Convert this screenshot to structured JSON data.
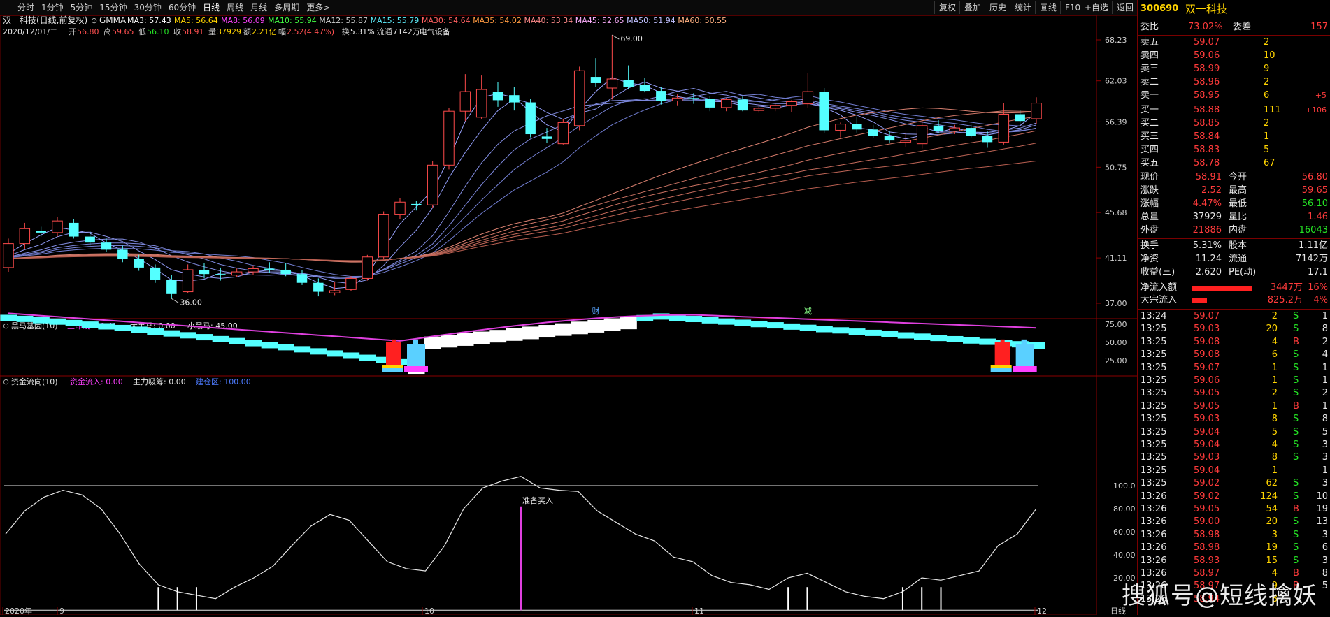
{
  "toolbar": {
    "periods": [
      "分时",
      "1分钟",
      "5分钟",
      "15分钟",
      "30分钟",
      "60分钟",
      "日线",
      "周线",
      "月线",
      "多周期",
      "更多>"
    ],
    "active_period": "日线",
    "right_buttons": [
      "复权",
      "叠加",
      "历史",
      "统计",
      "画线",
      "F10",
      "+自选",
      "返回"
    ]
  },
  "header": {
    "title": "双一科技(日线,前复权)",
    "indicator": "GMMA",
    "mas": [
      "MA3: 57.43",
      "MA5: 56.64",
      "MA8: 56.09",
      "MA10: 55.94",
      "MA12: 55.87",
      "MA15: 55.79",
      "MA30: 54.64",
      "MA35: 54.02",
      "MA40: 53.34",
      "MA45: 52.65",
      "MA50: 51.94",
      "MA60: 50.55"
    ],
    "info_date": "2020/12/01/二",
    "info_items": [
      {
        "k": "开",
        "v": "56.80"
      },
      {
        "k": "高",
        "v": "59.65"
      },
      {
        "k": "低",
        "v": "56.10"
      },
      {
        "k": "收",
        "v": "58.91"
      },
      {
        "k": "量",
        "v": "37929"
      },
      {
        "k": "额",
        "v": "2.21亿"
      },
      {
        "k": "幅",
        "v": "2.52(4.47%)"
      },
      {
        "k": "换",
        "v": "5.31%"
      },
      {
        "k": "流通",
        "v": "7142万"
      }
    ],
    "sector": "电气设备"
  },
  "chart_data": [
    {
      "type": "candlestick",
      "title": "双一科技(日线,前复权)",
      "y_ticks": [
        37.0,
        41.11,
        45.68,
        50.75,
        56.39,
        62.03,
        68.23
      ],
      "annotations": [
        {
          "text": "69.00",
          "x": 35
        },
        {
          "text": "36.00",
          "x": 10
        }
      ],
      "markers": [
        {
          "text": "财",
          "x": 36
        },
        {
          "text": "减",
          "x": 49
        }
      ],
      "candles": [
        [
          40.2,
          43.0,
          39.8,
          42.5
        ],
        [
          42.5,
          44.6,
          42.0,
          44.0
        ],
        [
          43.8,
          44.2,
          43.2,
          43.6
        ],
        [
          43.6,
          45.2,
          43.2,
          44.8
        ],
        [
          44.6,
          45.0,
          43.0,
          43.2
        ],
        [
          43.2,
          43.8,
          42.3,
          42.6
        ],
        [
          42.6,
          43.0,
          41.7,
          41.9
        ],
        [
          41.9,
          42.3,
          40.7,
          41.0
        ],
        [
          41.0,
          41.4,
          39.9,
          40.2
        ],
        [
          40.2,
          40.5,
          38.8,
          39.1
        ],
        [
          39.1,
          39.5,
          37.4,
          37.8
        ],
        [
          38.0,
          40.5,
          37.9,
          40.0
        ],
        [
          40.0,
          40.6,
          39.2,
          39.6
        ],
        [
          39.6,
          40.2,
          39.0,
          39.5
        ],
        [
          39.5,
          40.1,
          39.3,
          39.8
        ],
        [
          39.8,
          40.4,
          39.5,
          40.1
        ],
        [
          40.1,
          40.7,
          39.7,
          40.0
        ],
        [
          40.0,
          40.6,
          39.4,
          39.6
        ],
        [
          39.6,
          40.0,
          38.6,
          38.8
        ],
        [
          38.8,
          39.2,
          37.6,
          38.0
        ],
        [
          37.9,
          38.9,
          37.7,
          38.1
        ],
        [
          38.2,
          39.4,
          38.1,
          39.2
        ],
        [
          39.2,
          41.4,
          39.0,
          41.2
        ],
        [
          41.2,
          45.8,
          41.0,
          45.5
        ],
        [
          45.5,
          47.2,
          45.0,
          46.8
        ],
        [
          46.6,
          46.9,
          45.9,
          46.5
        ],
        [
          46.5,
          51.5,
          46.2,
          51.0
        ],
        [
          51.0,
          58.2,
          50.5,
          57.8
        ],
        [
          57.8,
          63.0,
          56.5,
          60.5
        ],
        [
          57.0,
          62.8,
          56.8,
          60.8
        ],
        [
          60.5,
          61.8,
          58.4,
          59.3
        ],
        [
          60.0,
          61.2,
          57.9,
          59.0
        ],
        [
          59.0,
          59.5,
          54.4,
          54.8
        ],
        [
          54.5,
          55.6,
          53.7,
          54.2
        ],
        [
          53.6,
          56.8,
          53.5,
          56.3
        ],
        [
          55.9,
          64.1,
          55.3,
          63.5
        ],
        [
          62.6,
          65.4,
          61.2,
          61.7
        ],
        [
          61.0,
          69.0,
          59.4,
          62.3
        ],
        [
          62.2,
          64.3,
          60.8,
          61.2
        ],
        [
          61.5,
          62.4,
          60.4,
          60.6
        ],
        [
          60.6,
          61.1,
          58.7,
          59.2
        ],
        [
          59.2,
          60.1,
          58.6,
          59.6
        ],
        [
          59.6,
          60.3,
          58.8,
          59.5
        ],
        [
          59.5,
          59.9,
          57.8,
          58.3
        ],
        [
          58.3,
          59.6,
          57.8,
          59.4
        ],
        [
          59.4,
          59.8,
          57.8,
          57.9
        ],
        [
          57.9,
          58.7,
          57.6,
          58.2
        ],
        [
          58.2,
          58.9,
          57.8,
          58.6
        ],
        [
          58.6,
          59.3,
          57.7,
          59.1
        ],
        [
          58.8,
          63.2,
          58.3,
          60.5
        ],
        [
          60.5,
          61.0,
          55.0,
          55.3
        ],
        [
          55.3,
          56.3,
          54.4,
          56.1
        ],
        [
          56.1,
          57.1,
          55.0,
          55.4
        ],
        [
          55.4,
          56.0,
          54.3,
          54.6
        ],
        [
          54.6,
          55.2,
          53.7,
          54.0
        ],
        [
          53.8,
          55.0,
          53.2,
          54.0
        ],
        [
          53.6,
          56.6,
          53.0,
          55.9
        ],
        [
          55.9,
          56.6,
          54.9,
          55.2
        ],
        [
          55.2,
          56.0,
          54.8,
          55.6
        ],
        [
          55.6,
          56.0,
          54.4,
          54.6
        ],
        [
          54.6,
          55.2,
          53.1,
          53.8
        ],
        [
          53.8,
          58.9,
          53.5,
          57.4
        ],
        [
          57.4,
          58.0,
          56.2,
          56.5
        ],
        [
          56.8,
          59.7,
          56.1,
          58.9
        ]
      ]
    },
    {
      "type": "area",
      "title": "黑马基因(10)",
      "series": [
        {
          "name": "生命线",
          "value": "58.41"
        },
        {
          "name": "大黑马",
          "value": "0.00"
        },
        {
          "name": "小黑马",
          "value": "45.00"
        }
      ],
      "y_ticks": [
        25.0,
        50.0,
        75.0
      ]
    },
    {
      "type": "line",
      "title": "资金流向(10)",
      "series": [
        {
          "name": "资金流入",
          "value": "0.00"
        },
        {
          "name": "主力吸筹",
          "value": "0.00"
        },
        {
          "name": "建仓区",
          "value": "100.00"
        }
      ],
      "y_ticks": [
        20.0,
        40.0,
        60.0,
        80.0,
        100.0
      ],
      "signal_label": "准备买入",
      "signals": [
        12,
        47,
        54
      ],
      "flow": [
        58,
        78,
        90,
        96,
        92,
        80,
        58,
        32,
        14,
        8,
        5,
        2,
        12,
        20,
        30,
        48,
        65,
        75,
        70,
        52,
        34,
        28,
        26,
        48,
        80,
        98,
        104,
        108,
        98,
        96,
        95,
        78,
        68,
        58,
        52,
        38,
        34,
        22,
        16,
        14,
        10,
        20,
        24,
        16,
        8,
        4,
        2,
        8,
        20,
        18,
        22,
        26,
        48,
        58,
        80
      ]
    }
  ],
  "xaxis": {
    "labels": [
      "2020年",
      "9",
      "10",
      "11",
      "12"
    ],
    "end_label": "日线"
  },
  "panel": {
    "code": "300690",
    "name": "双一科技",
    "weibi": {
      "label": "委比",
      "value": "73.02%",
      "label2": "委差",
      "value2": "157"
    },
    "asks": [
      {
        "label": "卖五",
        "price": "59.07",
        "vol": "2",
        "extra": ""
      },
      {
        "label": "卖四",
        "price": "59.06",
        "vol": "10",
        "extra": ""
      },
      {
        "label": "卖三",
        "price": "58.99",
        "vol": "9",
        "extra": ""
      },
      {
        "label": "卖二",
        "price": "58.96",
        "vol": "2",
        "extra": ""
      },
      {
        "label": "卖一",
        "price": "58.95",
        "vol": "6",
        "extra": "+5"
      }
    ],
    "bids": [
      {
        "label": "买一",
        "price": "58.88",
        "vol": "111",
        "extra": "+106"
      },
      {
        "label": "买二",
        "price": "58.85",
        "vol": "2",
        "extra": ""
      },
      {
        "label": "买三",
        "price": "58.84",
        "vol": "1",
        "extra": ""
      },
      {
        "label": "买四",
        "price": "58.83",
        "vol": "5",
        "extra": ""
      },
      {
        "label": "买五",
        "price": "58.78",
        "vol": "67",
        "extra": ""
      }
    ],
    "quote": [
      {
        "l1": "现价",
        "v1": "58.91",
        "c1": "red",
        "l2": "今开",
        "v2": "56.80",
        "c2": "red"
      },
      {
        "l1": "涨跌",
        "v1": "2.52",
        "c1": "red",
        "l2": "最高",
        "v2": "59.65",
        "c2": "red"
      },
      {
        "l1": "涨幅",
        "v1": "4.47%",
        "c1": "red",
        "l2": "最低",
        "v2": "56.10",
        "c2": "green"
      },
      {
        "l1": "总量",
        "v1": "37929",
        "c1": "white",
        "l2": "量比",
        "v2": "1.46",
        "c2": "red"
      },
      {
        "l1": "外盘",
        "v1": "21886",
        "c1": "red",
        "l2": "内盘",
        "v2": "16043",
        "c2": "green"
      }
    ],
    "quote2": [
      {
        "l1": "换手",
        "v1": "5.31%",
        "l2": "股本",
        "v2": "1.11亿"
      },
      {
        "l1": "净资",
        "v1": "11.24",
        "l2": "流通",
        "v2": "7142万"
      },
      {
        "l1": "收益(三)",
        "v1": "2.620",
        "l2": "PE(动)",
        "v2": "17.1"
      }
    ],
    "flows": [
      {
        "label": "净流入额",
        "value": "3447万",
        "pct": "16%",
        "bar": 1.0
      },
      {
        "label": "大宗流入",
        "value": "825.2万",
        "pct": "4%",
        "bar": 0.24
      }
    ],
    "ticks": [
      {
        "t": "13:24",
        "p": "59.07",
        "c": "red",
        "v": "2",
        "d": "S",
        "n": "1"
      },
      {
        "t": "13:25",
        "p": "59.03",
        "c": "red",
        "v": "20",
        "d": "S",
        "n": "8"
      },
      {
        "t": "13:25",
        "p": "59.08",
        "c": "red",
        "v": "4",
        "d": "B",
        "n": "2"
      },
      {
        "t": "13:25",
        "p": "59.08",
        "c": "red",
        "v": "6",
        "d": "S",
        "n": "4"
      },
      {
        "t": "13:25",
        "p": "59.07",
        "c": "red",
        "v": "1",
        "d": "S",
        "n": "1"
      },
      {
        "t": "13:25",
        "p": "59.06",
        "c": "red",
        "v": "1",
        "d": "S",
        "n": "1"
      },
      {
        "t": "13:25",
        "p": "59.05",
        "c": "red",
        "v": "2",
        "d": "S",
        "n": "2"
      },
      {
        "t": "13:25",
        "p": "59.05",
        "c": "red",
        "v": "1",
        "d": "B",
        "n": "1"
      },
      {
        "t": "13:25",
        "p": "59.03",
        "c": "red",
        "v": "8",
        "d": "S",
        "n": "8"
      },
      {
        "t": "13:25",
        "p": "59.04",
        "c": "red",
        "v": "5",
        "d": "S",
        "n": "5"
      },
      {
        "t": "13:25",
        "p": "59.04",
        "c": "red",
        "v": "4",
        "d": "S",
        "n": "3"
      },
      {
        "t": "13:25",
        "p": "59.03",
        "c": "red",
        "v": "8",
        "d": "S",
        "n": "3"
      },
      {
        "t": "13:25",
        "p": "59.04",
        "c": "red",
        "v": "1",
        "d": "",
        "n": "1"
      },
      {
        "t": "13:25",
        "p": "59.02",
        "c": "red",
        "v": "62",
        "d": "S",
        "n": "3"
      },
      {
        "t": "13:26",
        "p": "59.02",
        "c": "red",
        "v": "124",
        "d": "S",
        "n": "10"
      },
      {
        "t": "13:26",
        "p": "59.05",
        "c": "red",
        "v": "54",
        "d": "B",
        "n": "19"
      },
      {
        "t": "13:26",
        "p": "59.00",
        "c": "red",
        "v": "20",
        "d": "S",
        "n": "13"
      },
      {
        "t": "13:26",
        "p": "58.98",
        "c": "red",
        "v": "3",
        "d": "S",
        "n": "3"
      },
      {
        "t": "13:26",
        "p": "58.98",
        "c": "red",
        "v": "19",
        "d": "S",
        "n": "6"
      },
      {
        "t": "13:26",
        "p": "58.93",
        "c": "red",
        "v": "15",
        "d": "S",
        "n": "3"
      },
      {
        "t": "13:26",
        "p": "58.97",
        "c": "red",
        "v": "4",
        "d": "B",
        "n": "8"
      },
      {
        "t": "13:26",
        "p": "58.97",
        "c": "red",
        "v": "9",
        "d": "B",
        "n": "5"
      },
      {
        "t": "13:26",
        "p": "58.94",
        "c": "red",
        "v": "8",
        "d": "",
        "n": ""
      }
    ]
  },
  "watermark": "搜狐号@短线擒妖"
}
